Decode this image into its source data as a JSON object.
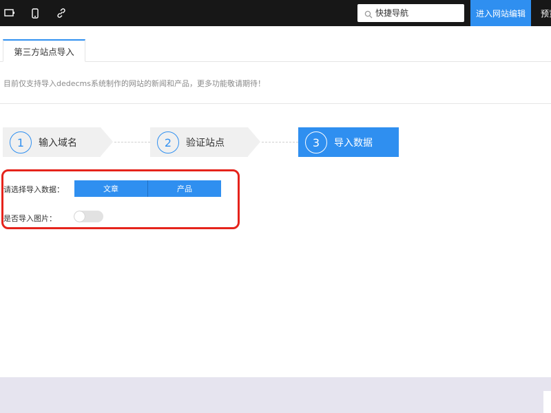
{
  "topbar": {
    "icons": [
      "desktop-icon",
      "mobile-icon",
      "link-icon"
    ],
    "search": {
      "placeholder": "快捷导航"
    },
    "edit_button": "进入网站编辑",
    "preview_button": "预览"
  },
  "tabs": [
    {
      "label": "第三方站点导入",
      "active": true
    }
  ],
  "tip": "目前仅支持导入dedecms系统制作的网站的新闻和产品，更多功能敬请期待！",
  "steps": [
    {
      "number": "1",
      "label": "输入域名",
      "active": false
    },
    {
      "number": "2",
      "label": "验证站点",
      "active": false
    },
    {
      "number": "3",
      "label": "导入数据",
      "active": true
    }
  ],
  "form": {
    "data_label": "请选择导入数据：",
    "options": [
      "文章",
      "产品"
    ],
    "images_label": "是否导入图片：",
    "images_enabled": false
  },
  "colors": {
    "accent": "#2f8ff0",
    "topbar": "#171717",
    "highlight": "#e5231b",
    "footer": "#e6e4ef"
  }
}
